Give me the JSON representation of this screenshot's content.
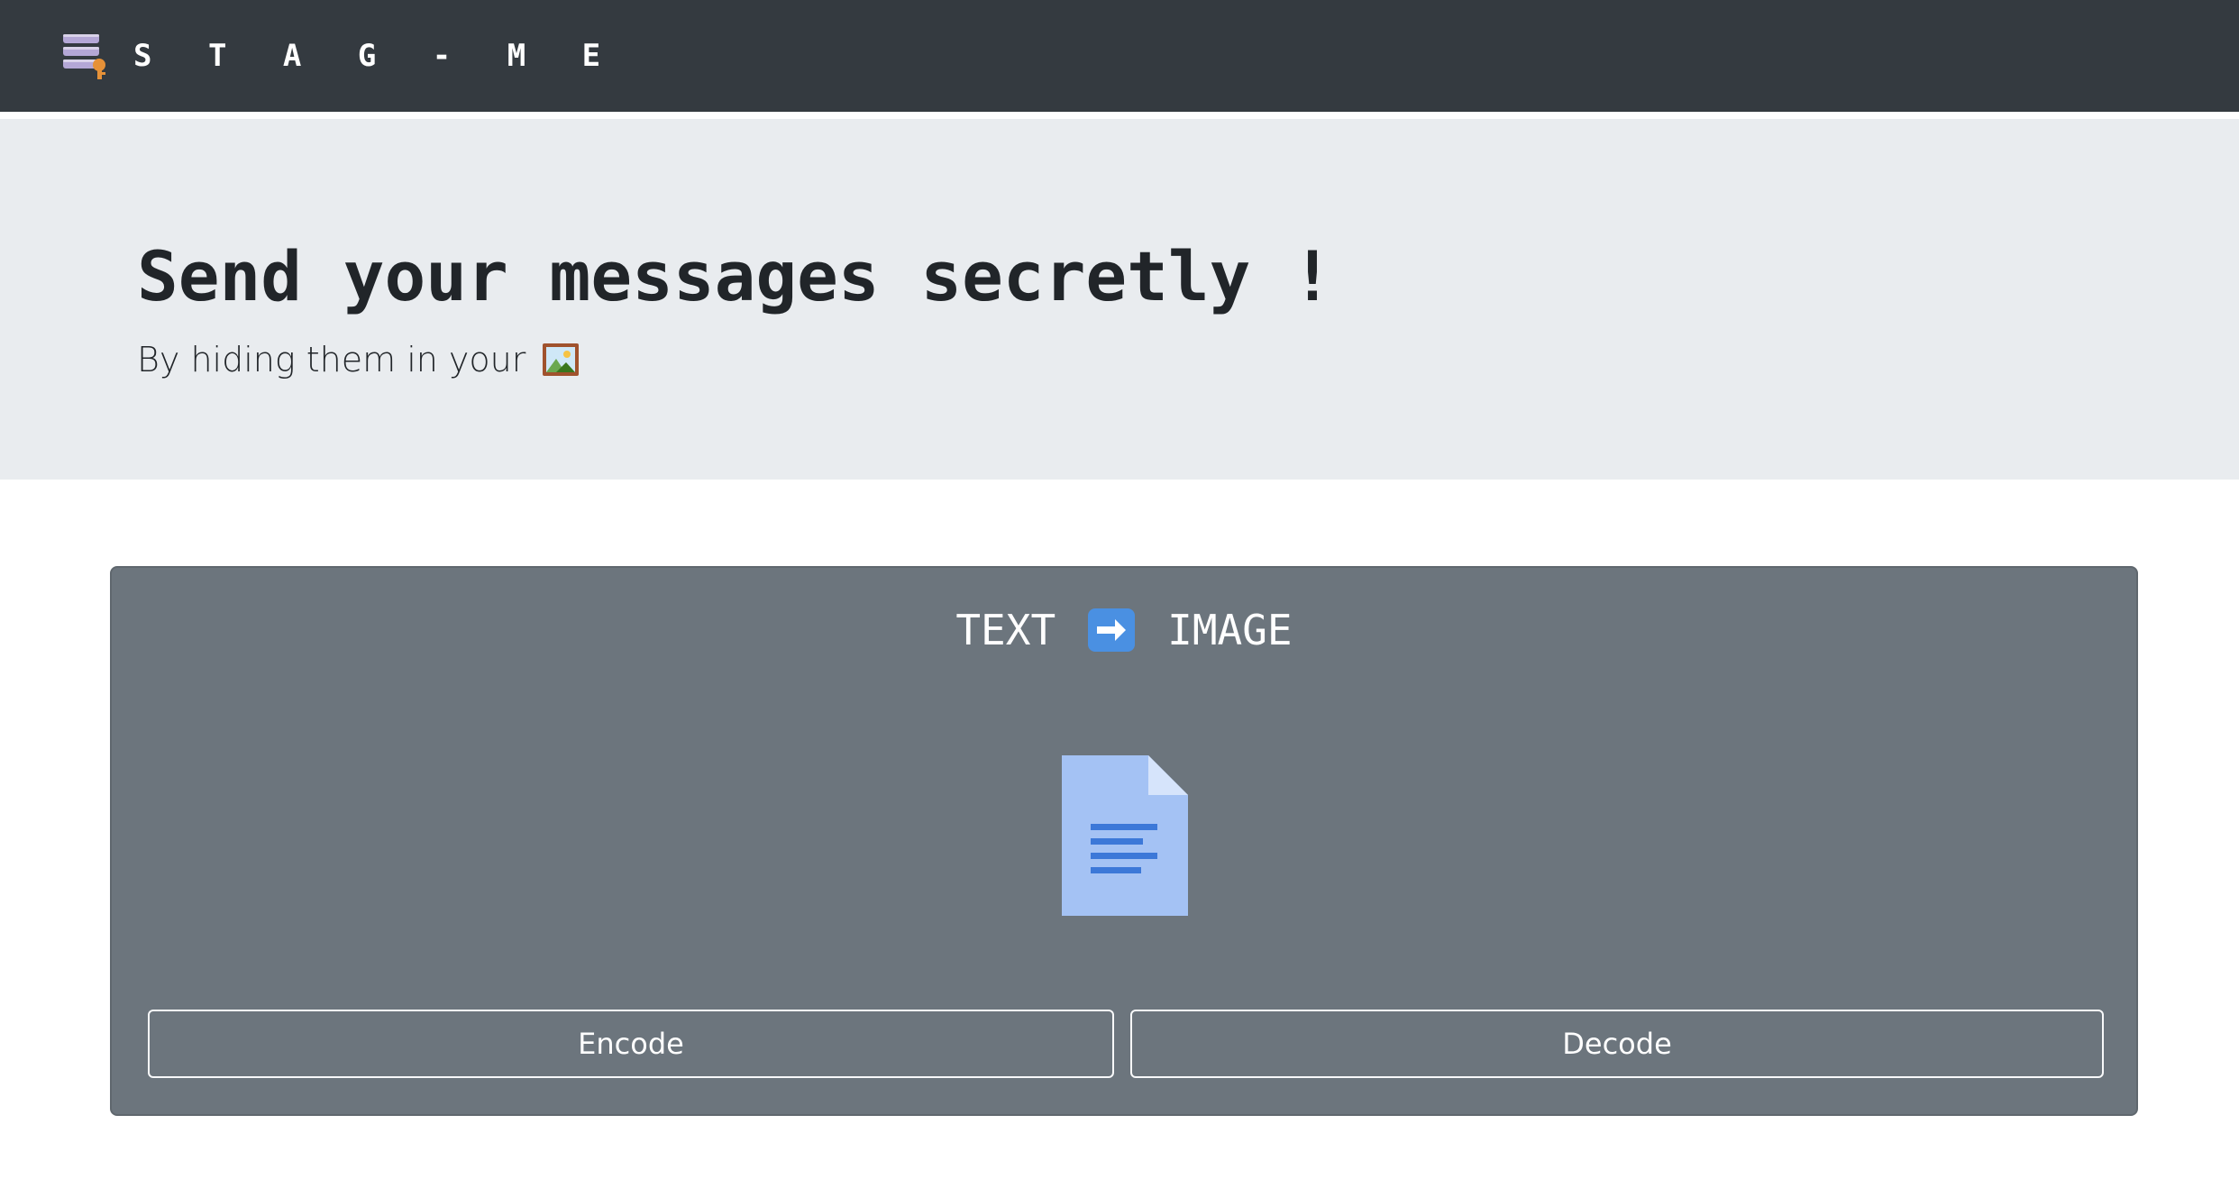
{
  "navbar": {
    "brand": "S T A G - M E",
    "logo_icon": "database-key-icon"
  },
  "hero": {
    "title": "Send your messages secretly !",
    "subtitle": "By hiding them in your",
    "subtitle_icon": "framed-picture-icon"
  },
  "card": {
    "header_left": "TEXT",
    "header_arrow_icon": "right-arrow-icon",
    "header_right": "IMAGE",
    "center_icon": "document-icon",
    "encode_label": "Encode",
    "decode_label": "Decode"
  },
  "colors": {
    "navbar_bg": "#343a40",
    "hero_bg": "#e9ecef",
    "card_bg": "#6c757d",
    "accent_blue": "#4a90e2",
    "doc_blue": "#a4c2f4"
  }
}
